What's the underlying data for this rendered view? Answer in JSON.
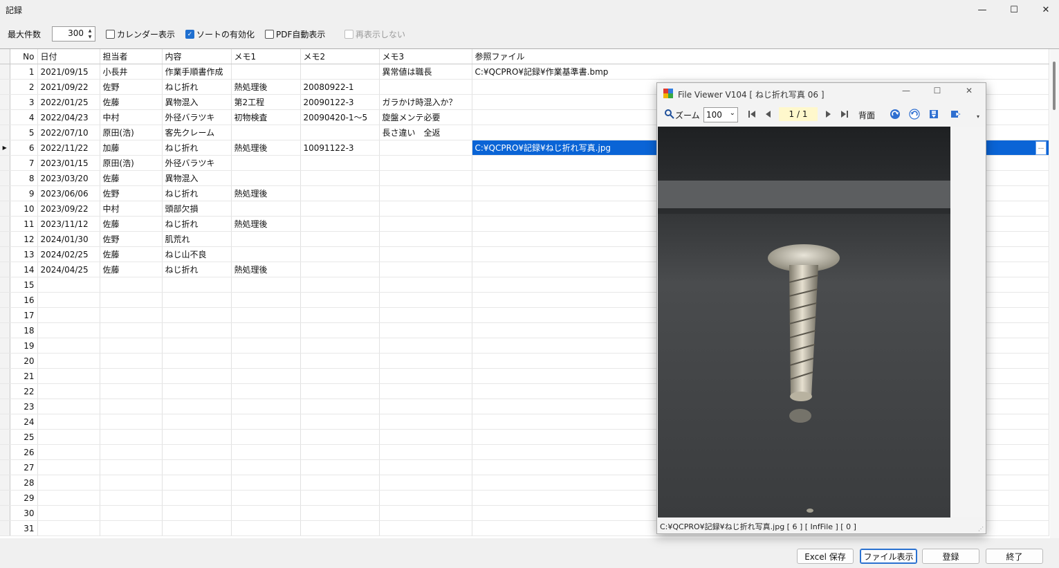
{
  "window": {
    "title": "記録",
    "minimize": "—",
    "maximize": "☐",
    "close": "✕"
  },
  "toolbar": {
    "max_label": "最大件数",
    "max_value": "300",
    "calendar": "カレンダー表示",
    "calendar_checked": false,
    "sort": "ソートの有効化",
    "sort_checked": true,
    "pdf": "PDF自動表示",
    "pdf_checked": false,
    "redisplay": "再表示しない",
    "redisplay_checked": false
  },
  "grid": {
    "columns": [
      "No",
      "日付",
      "担当者",
      "内容",
      "メモ1",
      "メモ2",
      "メモ3",
      "参照ファイル"
    ],
    "selected_row": 6,
    "rows": [
      {
        "no": "1",
        "date": "2021/09/15",
        "person": "小長井",
        "content": "作業手順書作成",
        "memo1": "",
        "memo2": "",
        "memo3": "異常値は職長",
        "file": "C:¥QCPRO¥記録¥作業基準書.bmp"
      },
      {
        "no": "2",
        "date": "2021/09/22",
        "person": "佐野",
        "content": "ねじ折れ",
        "memo1": "熱処理後",
        "memo2": "20080922-1",
        "memo3": "",
        "file": ""
      },
      {
        "no": "3",
        "date": "2022/01/25",
        "person": "佐藤",
        "content": "異物混入",
        "memo1": "第2工程",
        "memo2": "20090122-3",
        "memo3": "ガラかけ時混入か？",
        "file": ""
      },
      {
        "no": "4",
        "date": "2022/04/23",
        "person": "中村",
        "content": "外径バラツキ",
        "memo1": "初物検査",
        "memo2": "20090420-1～5",
        "memo3": "旋盤メンテ必要",
        "file": ""
      },
      {
        "no": "5",
        "date": "2022/07/10",
        "person": "原田(浩)",
        "content": "客先クレーム",
        "memo1": "",
        "memo2": "",
        "memo3": "長さ違い　全返",
        "file": ""
      },
      {
        "no": "6",
        "date": "2022/11/22",
        "person": "加藤",
        "content": "ねじ折れ",
        "memo1": "熱処理後",
        "memo2": "10091122-3",
        "memo3": "",
        "file": "C:¥QCPRO¥記録¥ねじ折れ写真.jpg"
      },
      {
        "no": "7",
        "date": "2023/01/15",
        "person": "原田(浩)",
        "content": "外径バラツキ",
        "memo1": "",
        "memo2": "",
        "memo3": "",
        "file": ""
      },
      {
        "no": "8",
        "date": "2023/03/20",
        "person": "佐藤",
        "content": "異物混入",
        "memo1": "",
        "memo2": "",
        "memo3": "",
        "file": ""
      },
      {
        "no": "9",
        "date": "2023/06/06",
        "person": "佐野",
        "content": "ねじ折れ",
        "memo1": "熱処理後",
        "memo2": "",
        "memo3": "",
        "file": ""
      },
      {
        "no": "10",
        "date": "2023/09/22",
        "person": "中村",
        "content": "頭部欠損",
        "memo1": "",
        "memo2": "",
        "memo3": "",
        "file": ""
      },
      {
        "no": "11",
        "date": "2023/11/12",
        "person": "佐藤",
        "content": "ねじ折れ",
        "memo1": "熱処理後",
        "memo2": "",
        "memo3": "",
        "file": ""
      },
      {
        "no": "12",
        "date": "2024/01/30",
        "person": "佐野",
        "content": "肌荒れ",
        "memo1": "",
        "memo2": "",
        "memo3": "",
        "file": ""
      },
      {
        "no": "13",
        "date": "2024/02/25",
        "person": "佐藤",
        "content": "ねじ山不良",
        "memo1": "",
        "memo2": "",
        "memo3": "",
        "file": ""
      },
      {
        "no": "14",
        "date": "2024/04/25",
        "person": "佐藤",
        "content": "ねじ折れ",
        "memo1": "熱処理後",
        "memo2": "",
        "memo3": "",
        "file": ""
      },
      {
        "no": "15",
        "date": "",
        "person": "",
        "content": "",
        "memo1": "",
        "memo2": "",
        "memo3": "",
        "file": ""
      },
      {
        "no": "16",
        "date": "",
        "person": "",
        "content": "",
        "memo1": "",
        "memo2": "",
        "memo3": "",
        "file": ""
      },
      {
        "no": "17",
        "date": "",
        "person": "",
        "content": "",
        "memo1": "",
        "memo2": "",
        "memo3": "",
        "file": ""
      },
      {
        "no": "18",
        "date": "",
        "person": "",
        "content": "",
        "memo1": "",
        "memo2": "",
        "memo3": "",
        "file": ""
      },
      {
        "no": "19",
        "date": "",
        "person": "",
        "content": "",
        "memo1": "",
        "memo2": "",
        "memo3": "",
        "file": ""
      },
      {
        "no": "20",
        "date": "",
        "person": "",
        "content": "",
        "memo1": "",
        "memo2": "",
        "memo3": "",
        "file": ""
      },
      {
        "no": "21",
        "date": "",
        "person": "",
        "content": "",
        "memo1": "",
        "memo2": "",
        "memo3": "",
        "file": ""
      },
      {
        "no": "22",
        "date": "",
        "person": "",
        "content": "",
        "memo1": "",
        "memo2": "",
        "memo3": "",
        "file": ""
      },
      {
        "no": "23",
        "date": "",
        "person": "",
        "content": "",
        "memo1": "",
        "memo2": "",
        "memo3": "",
        "file": ""
      },
      {
        "no": "24",
        "date": "",
        "person": "",
        "content": "",
        "memo1": "",
        "memo2": "",
        "memo3": "",
        "file": ""
      },
      {
        "no": "25",
        "date": "",
        "person": "",
        "content": "",
        "memo1": "",
        "memo2": "",
        "memo3": "",
        "file": ""
      },
      {
        "no": "26",
        "date": "",
        "person": "",
        "content": "",
        "memo1": "",
        "memo2": "",
        "memo3": "",
        "file": ""
      },
      {
        "no": "27",
        "date": "",
        "person": "",
        "content": "",
        "memo1": "",
        "memo2": "",
        "memo3": "",
        "file": ""
      },
      {
        "no": "28",
        "date": "",
        "person": "",
        "content": "",
        "memo1": "",
        "memo2": "",
        "memo3": "",
        "file": ""
      },
      {
        "no": "29",
        "date": "",
        "person": "",
        "content": "",
        "memo1": "",
        "memo2": "",
        "memo3": "",
        "file": ""
      },
      {
        "no": "30",
        "date": "",
        "person": "",
        "content": "",
        "memo1": "",
        "memo2": "",
        "memo3": "",
        "file": ""
      },
      {
        "no": "31",
        "date": "",
        "person": "",
        "content": "",
        "memo1": "",
        "memo2": "",
        "memo3": "",
        "file": ""
      }
    ],
    "ellipsis": "..."
  },
  "buttons": {
    "excel": "Excel 保存",
    "file_view": "ファイル表示",
    "register": "登録",
    "exit": "終了"
  },
  "viewer": {
    "title": "File Viewer  V104 [ ねじ折れ写真  06 ]",
    "zoom_label": "ズーム",
    "zoom_value": "100",
    "page": "1 / 1",
    "back_label": "背面",
    "status": "C:¥QCPRO¥記録¥ねじ折れ写真.jpg  [ 6 ]  [ InfFile ]  [ 0 ]",
    "icons": [
      "search-icon",
      "first-page-icon",
      "prev-page-icon",
      "next-page-icon",
      "last-page-icon",
      "rotate-right-icon",
      "rotate-left-icon",
      "save-icon",
      "export-icon"
    ]
  },
  "colors": {
    "selection": "#0a64d6",
    "page_highlight": "#fff8cc",
    "checkbox_on": "#1f6fd0"
  }
}
